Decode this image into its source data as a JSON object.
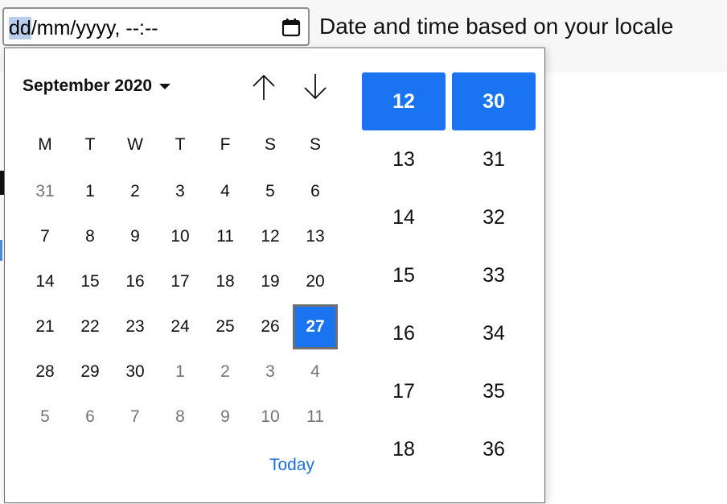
{
  "input": {
    "day_placeholder": "dd",
    "rest_placeholder": "/mm/yyyy, --:--"
  },
  "side_label": "Date and time based on your locale",
  "icons": {
    "calendar": "calendar-icon",
    "month_dropdown": "caret-down-icon",
    "prev_month": "arrow-up-icon",
    "next_month": "arrow-down-icon"
  },
  "calendar": {
    "month_label": "September 2020",
    "weekdays": [
      "M",
      "T",
      "W",
      "T",
      "F",
      "S",
      "S"
    ],
    "weeks": [
      [
        {
          "d": "31",
          "other": true
        },
        {
          "d": "1"
        },
        {
          "d": "2"
        },
        {
          "d": "3"
        },
        {
          "d": "4"
        },
        {
          "d": "5"
        },
        {
          "d": "6"
        }
      ],
      [
        {
          "d": "7"
        },
        {
          "d": "8"
        },
        {
          "d": "9"
        },
        {
          "d": "10"
        },
        {
          "d": "11"
        },
        {
          "d": "12"
        },
        {
          "d": "13"
        }
      ],
      [
        {
          "d": "14"
        },
        {
          "d": "15"
        },
        {
          "d": "16"
        },
        {
          "d": "17"
        },
        {
          "d": "18"
        },
        {
          "d": "19"
        },
        {
          "d": "20"
        }
      ],
      [
        {
          "d": "21"
        },
        {
          "d": "22"
        },
        {
          "d": "23"
        },
        {
          "d": "24"
        },
        {
          "d": "25"
        },
        {
          "d": "26"
        },
        {
          "d": "27",
          "selected": true
        }
      ],
      [
        {
          "d": "28"
        },
        {
          "d": "29"
        },
        {
          "d": "30"
        },
        {
          "d": "1",
          "other": true
        },
        {
          "d": "2",
          "other": true
        },
        {
          "d": "3",
          "other": true
        },
        {
          "d": "4",
          "other": true
        }
      ],
      [
        {
          "d": "5",
          "other": true
        },
        {
          "d": "6",
          "other": true
        },
        {
          "d": "7",
          "other": true
        },
        {
          "d": "8",
          "other": true
        },
        {
          "d": "9",
          "other": true
        },
        {
          "d": "10",
          "other": true
        },
        {
          "d": "11",
          "other": true
        }
      ]
    ],
    "today_label": "Today"
  },
  "time": {
    "hours": [
      "12",
      "13",
      "14",
      "15",
      "16",
      "17",
      "18"
    ],
    "minutes": [
      "30",
      "31",
      "32",
      "33",
      "34",
      "35",
      "36"
    ],
    "selected_hour": "12",
    "selected_minute": "30"
  },
  "colors": {
    "accent": "#1a73f0",
    "link": "#1a6fdc",
    "muted_day": "#747474",
    "segment_highlight": "#b8cdea"
  }
}
